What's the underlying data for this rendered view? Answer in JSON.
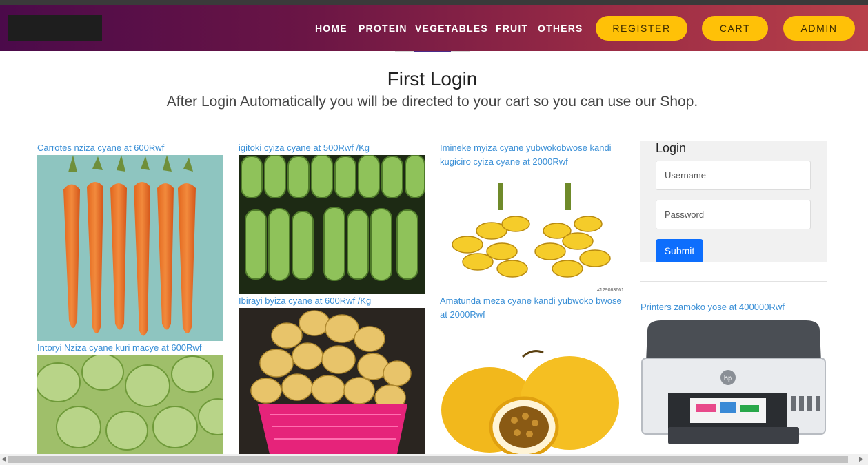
{
  "nav": {
    "links": [
      "HOME",
      "PROTEIN",
      "VEGETABLES",
      "FRUIT",
      "OTHERS"
    ],
    "register_label": "REGISTER",
    "cart_label": "CART",
    "admin_label": "ADMIN"
  },
  "page": {
    "title": "First Login",
    "subtitle": "After Login Automatically you will be directed to your cart so you can use our Shop."
  },
  "products": [
    {
      "caption": "Carrotes nziza cyane at 600Rwf",
      "image": "carrots"
    },
    {
      "caption": "Intoryi Nziza cyane kuri macye at 600Rwf",
      "image": "eggplants"
    },
    {
      "caption": "igitoki cyiza cyane at 500Rwf /Kg",
      "image": "green-bananas"
    },
    {
      "caption": "Ibirayi byiza cyane at 600Rwf /Kg",
      "image": "potatoes"
    },
    {
      "caption": "Imineke myiza cyane yubwokobwose kandi kugiciro cyiza cyane at 2000Rwf",
      "image": "yellow-bananas"
    },
    {
      "caption": "Amatunda meza cyane kandi yubwoko bwose at 2000Rwf",
      "image": "passion-fruit"
    },
    {
      "caption": "Printers zamoko yose at 400000Rwf",
      "image": "printer"
    }
  ],
  "login": {
    "title": "Login",
    "username_placeholder": "Username",
    "password_placeholder": "Password",
    "submit_label": "Submit"
  },
  "image_text": {
    "watermark": "#129083661",
    "printer_brand": "hp"
  }
}
